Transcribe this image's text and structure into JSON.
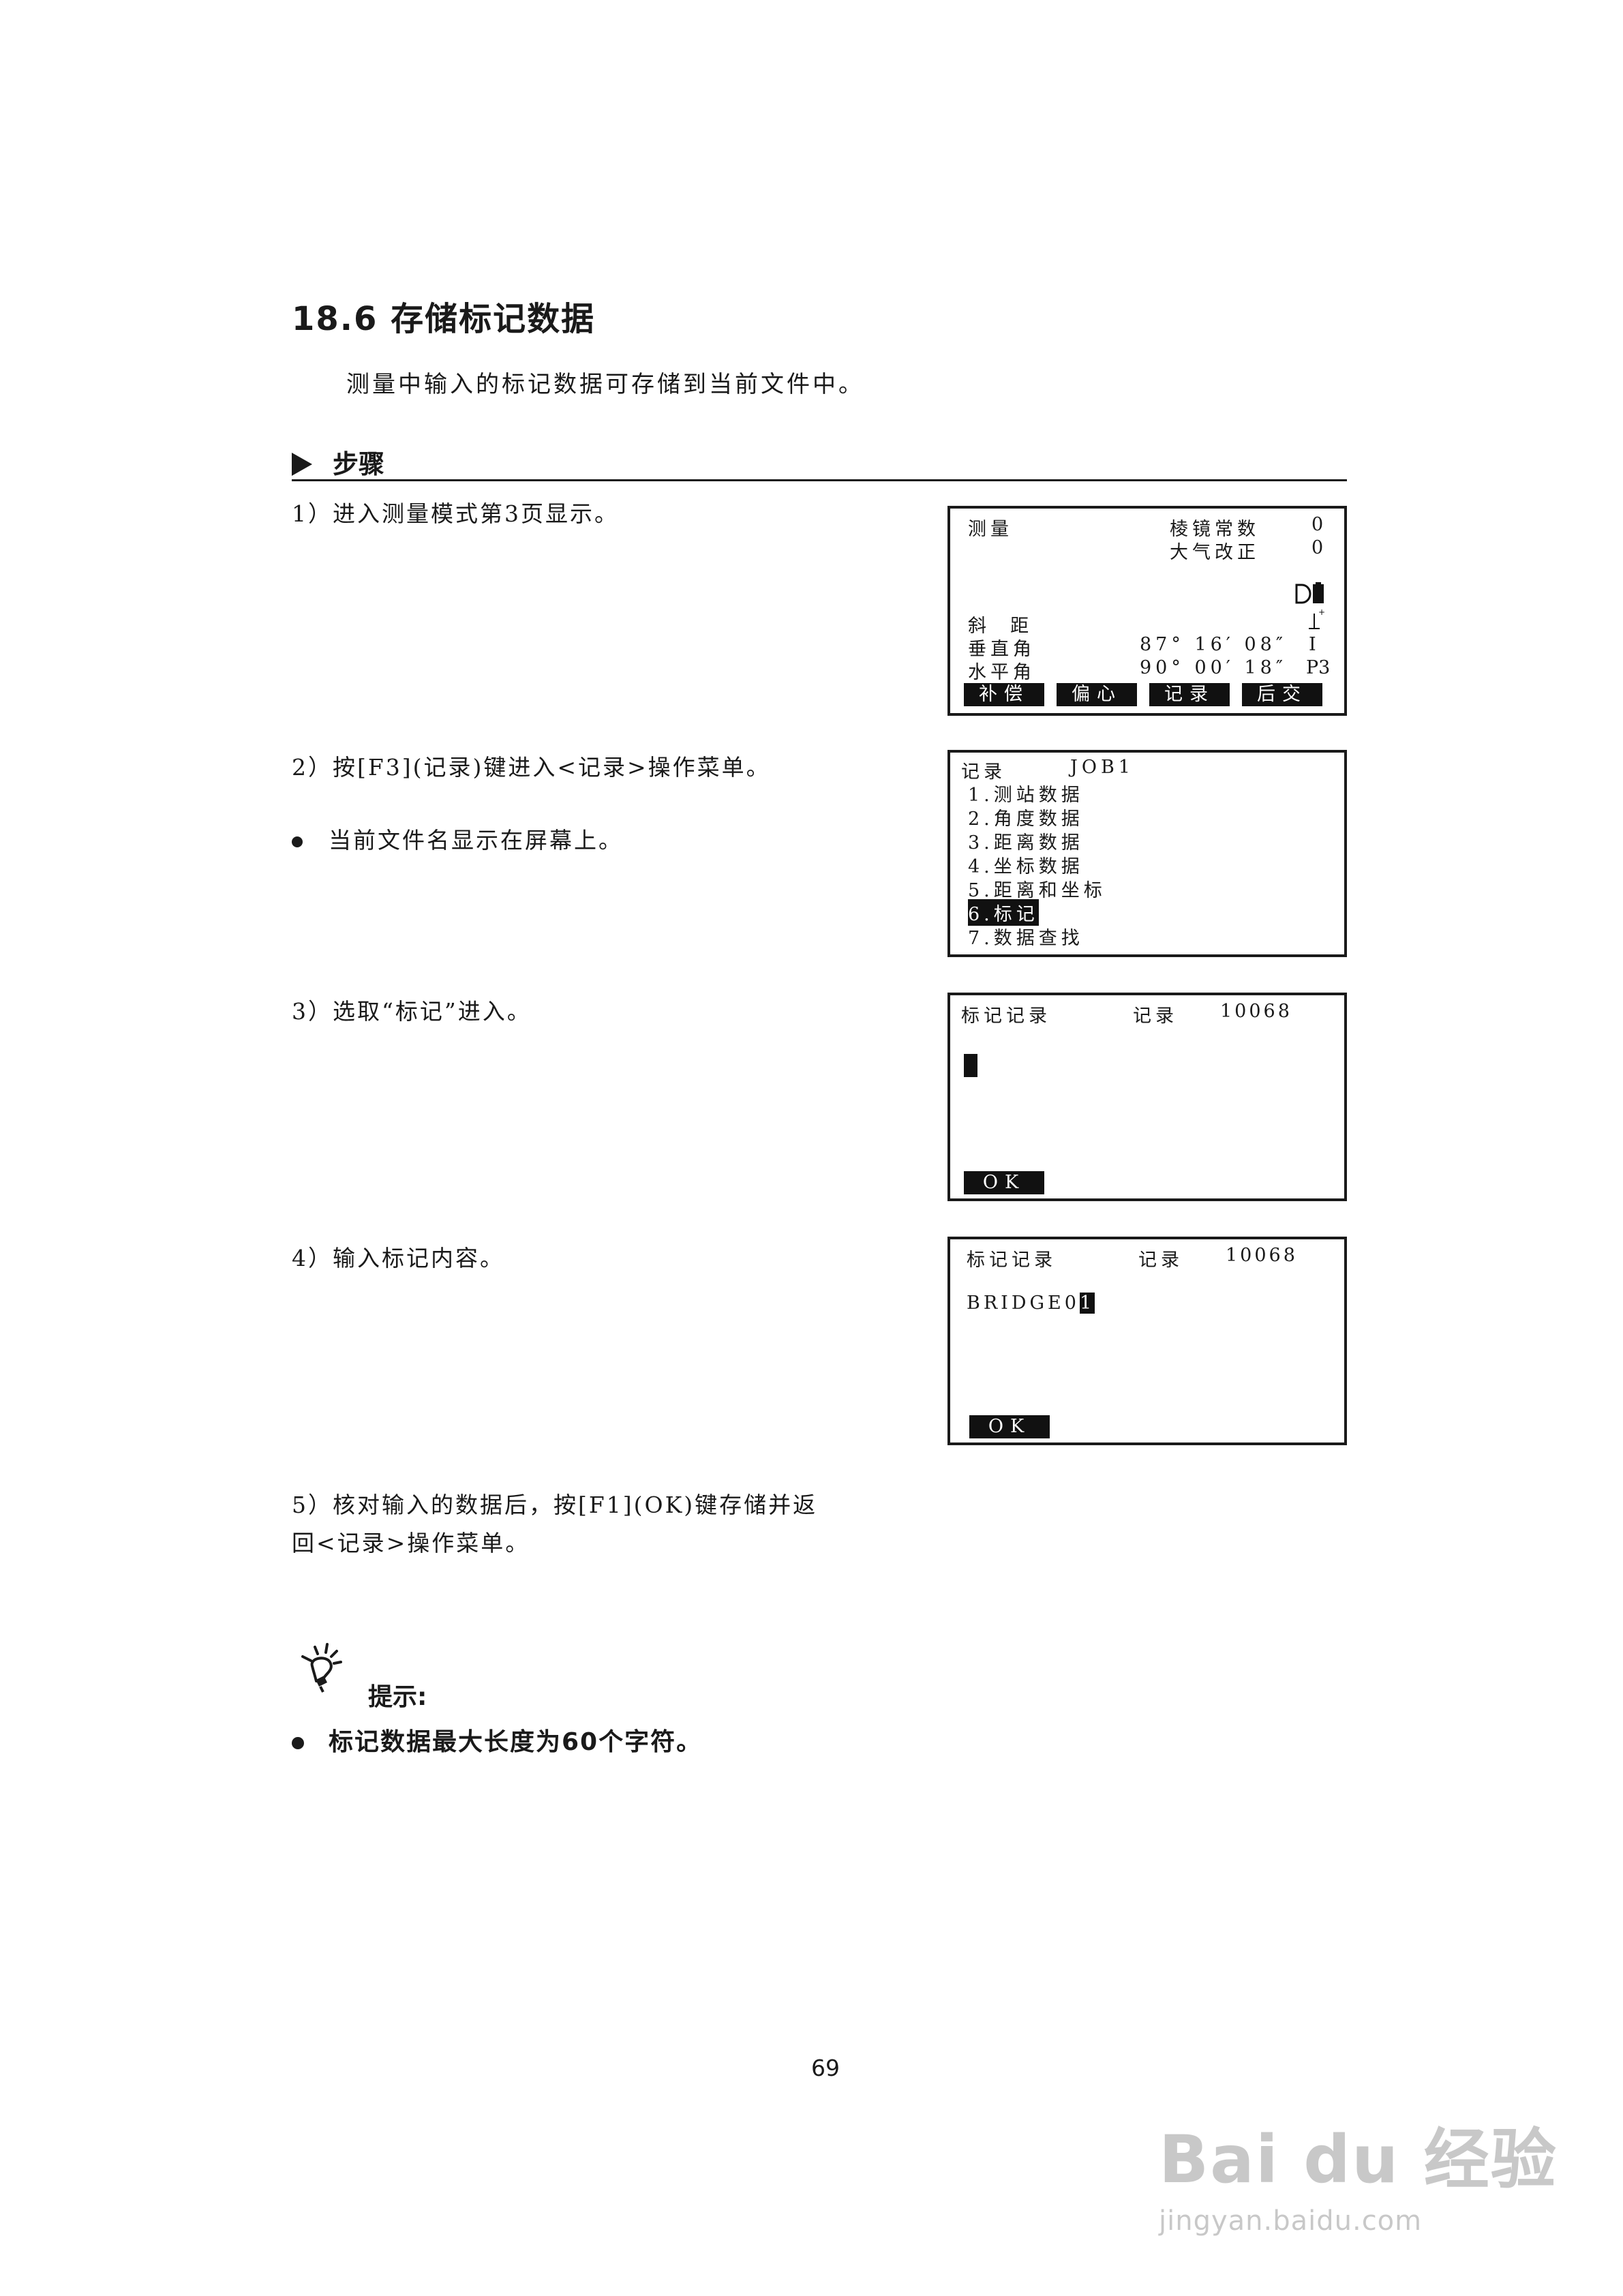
{
  "section_title": "18.6 存储标记数据",
  "intro": "测量中输入的标记数据可存储到当前文件中。",
  "steps_heading": "步骤",
  "steps": {
    "s1": "1）进入测量模式第3页显示。",
    "s2": "2）按[F3](记录)键进入<记录>操作菜单。",
    "s2_bullet": "当前文件名显示在屏幕上。",
    "s3": "3）选取“标记”进入。",
    "s4": "4）输入标记内容。",
    "s5_line1": "5）核对输入的数据后，按[F1](OK)键存储并返",
    "s5_line2": "回<记录>操作菜单。"
  },
  "screen1": {
    "mode": "测量",
    "prism_label": "棱镜常数",
    "prism_value": "0",
    "atm_label": "大气改正",
    "atm_value": "0",
    "slope_label": "斜  距",
    "vert_label": "垂直角",
    "vert_value": "87° 16′ 08″",
    "horiz_label": "水平角",
    "horiz_value": "90° 00′ 18″",
    "page": "P3",
    "keys": [
      "补偿",
      "偏心",
      "记录",
      "后交"
    ]
  },
  "screen2": {
    "title": "记录",
    "job": "JOB1",
    "items": [
      "1.测站数据",
      "2.角度数据",
      "3.距离数据",
      "4.坐标数据",
      "5.距离和坐标",
      "6.标记",
      "7.数据查找"
    ]
  },
  "screen3": {
    "title": "标记记录",
    "rec_label": "记录",
    "rec_no": "10068",
    "ok": "OK"
  },
  "screen4": {
    "title": "标记记录",
    "rec_label": "记录",
    "rec_no": "10068",
    "input_text": "BRIDGE0",
    "input_cursor_char": "1",
    "ok": "OK"
  },
  "tip": {
    "heading": "提示:",
    "text": "标记数据最大长度为60个字符。"
  },
  "page_number": "69",
  "watermark": {
    "brand": "Bai du 经验",
    "url": "jingyan.baidu.com"
  }
}
